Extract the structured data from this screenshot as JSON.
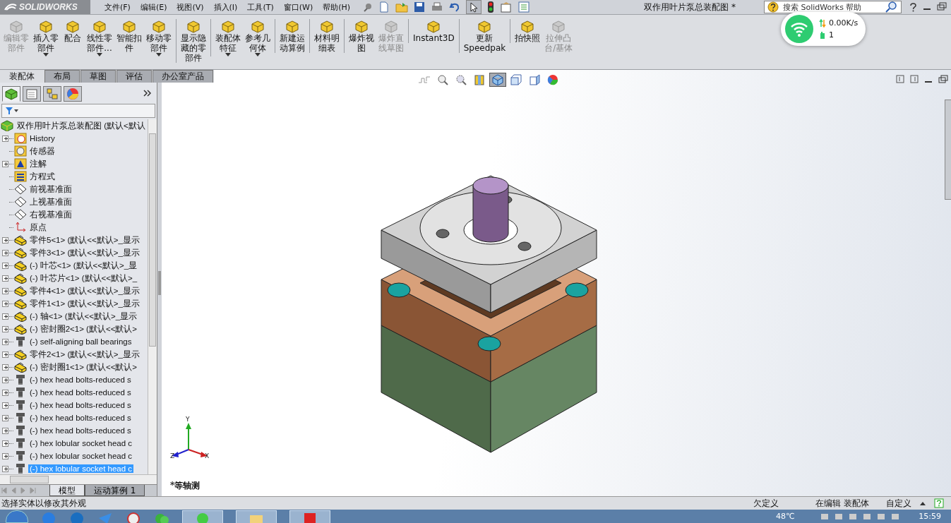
{
  "titlebar": {
    "brand": "SOLIDWORKS",
    "menu": [
      "文件(F)",
      "编辑(E)",
      "视图(V)",
      "插入(I)",
      "工具(T)",
      "窗口(W)",
      "帮助(H)"
    ],
    "title": "双作用叶片泵总装配图 *",
    "search": {
      "placeholder": "搜索 SolidWorks 帮助"
    }
  },
  "network_widget": {
    "speed": "0.00K/s",
    "count": "1"
  },
  "commands": [
    {
      "lines": [
        "编辑零",
        "部件"
      ],
      "disabled": true,
      "has_menu": false,
      "separator_before": false
    },
    {
      "lines": [
        "插入零",
        "部件"
      ],
      "disabled": false,
      "has_menu": true,
      "separator_before": false
    },
    {
      "lines": [
        "配合"
      ],
      "disabled": false,
      "has_menu": false,
      "separator_before": false
    },
    {
      "lines": [
        "线性零",
        "部件..."
      ],
      "disabled": false,
      "has_menu": true,
      "separator_before": false
    },
    {
      "lines": [
        "智能扣",
        "件"
      ],
      "disabled": false,
      "has_menu": false,
      "separator_before": false
    },
    {
      "lines": [
        "移动零",
        "部件"
      ],
      "disabled": false,
      "has_menu": true,
      "separator_before": false
    },
    {
      "lines": [
        "显示隐",
        "藏的零",
        "部件"
      ],
      "disabled": false,
      "has_menu": false,
      "separator_before": true
    },
    {
      "lines": [
        "装配体",
        "特征"
      ],
      "disabled": false,
      "has_menu": true,
      "separator_before": true
    },
    {
      "lines": [
        "参考几",
        "何体"
      ],
      "disabled": false,
      "has_menu": true,
      "separator_before": false
    },
    {
      "lines": [
        "新建运",
        "动算例"
      ],
      "disabled": false,
      "has_menu": false,
      "separator_before": true
    },
    {
      "lines": [
        "材料明",
        "细表"
      ],
      "disabled": false,
      "has_menu": false,
      "separator_before": true
    },
    {
      "lines": [
        "爆炸视",
        "图"
      ],
      "disabled": false,
      "has_menu": false,
      "separator_before": true
    },
    {
      "lines": [
        "爆炸直",
        "线草图"
      ],
      "disabled": true,
      "has_menu": false,
      "separator_before": false
    },
    {
      "lines": [
        "Instant3D"
      ],
      "disabled": false,
      "has_menu": false,
      "separator_before": true
    },
    {
      "lines": [
        "更新",
        "Speedpak"
      ],
      "disabled": false,
      "has_menu": false,
      "separator_before": true
    },
    {
      "lines": [
        "拍快照"
      ],
      "disabled": false,
      "has_menu": false,
      "separator_before": true
    },
    {
      "lines": [
        "拉伸凸",
        "台/基体"
      ],
      "disabled": true,
      "has_menu": false,
      "separator_before": false
    }
  ],
  "tabs": [
    {
      "label": "装配体",
      "selected": true
    },
    {
      "label": "布局",
      "selected": false
    },
    {
      "label": "草图",
      "selected": false
    },
    {
      "label": "评估",
      "selected": false
    },
    {
      "label": "办公室产品",
      "selected": false
    }
  ],
  "panel_tabs": [
    {
      "kind": "tree",
      "selected": true
    },
    {
      "kind": "property",
      "selected": false
    },
    {
      "kind": "config",
      "selected": false
    },
    {
      "kind": "display",
      "selected": false
    }
  ],
  "tree": {
    "text": "双作用叶片泵总装配图  (默认<默认",
    "kind": "assembly",
    "children": [
      {
        "text": "History",
        "kind": "history",
        "expandable": true,
        "selected": false
      },
      {
        "text": "传感器",
        "kind": "sensor",
        "expandable": false,
        "selected": false
      },
      {
        "text": "注解",
        "kind": "annotation",
        "expandable": true,
        "selected": false
      },
      {
        "text": "方程式",
        "kind": "equation",
        "expandable": false,
        "selected": false
      },
      {
        "text": "前视基准面",
        "kind": "plane",
        "expandable": false,
        "selected": false
      },
      {
        "text": "上视基准面",
        "kind": "plane",
        "expandable": false,
        "selected": false
      },
      {
        "text": "右视基准面",
        "kind": "plane",
        "expandable": false,
        "selected": false
      },
      {
        "text": "原点",
        "kind": "origin",
        "expandable": false,
        "selected": false
      },
      {
        "text": "零件5<1> (默认<<默认>_显示",
        "kind": "part",
        "expandable": true,
        "selected": false
      },
      {
        "text": "零件3<1> (默认<<默认>_显示",
        "kind": "part",
        "expandable": true,
        "selected": false
      },
      {
        "text": "(-) 叶芯<1> (默认<<默认>_显",
        "kind": "part",
        "expandable": true,
        "selected": false
      },
      {
        "text": "(-) 叶芯片<1> (默认<<默认>_",
        "kind": "part",
        "expandable": true,
        "selected": false
      },
      {
        "text": "零件4<1> (默认<<默认>_显示",
        "kind": "part",
        "expandable": true,
        "selected": false
      },
      {
        "text": "零件1<1> (默认<<默认>_显示",
        "kind": "part",
        "expandable": true,
        "selected": false
      },
      {
        "text": "(-) 轴<1> (默认<<默认>_显示",
        "kind": "part",
        "expandable": true,
        "selected": false
      },
      {
        "text": "(-) 密封圈2<1> (默认<<默认>",
        "kind": "part",
        "expandable": true,
        "selected": false
      },
      {
        "text": "(-) self-aligning ball bearings",
        "kind": "bolt",
        "expandable": true,
        "selected": false
      },
      {
        "text": "零件2<1> (默认<<默认>_显示",
        "kind": "part",
        "expandable": true,
        "selected": false
      },
      {
        "text": "(-) 密封圈1<1> (默认<<默认>",
        "kind": "part",
        "expandable": true,
        "selected": false
      },
      {
        "text": "(-) hex head bolts-reduced s",
        "kind": "bolt",
        "expandable": true,
        "selected": false
      },
      {
        "text": "(-) hex head bolts-reduced s",
        "kind": "bolt",
        "expandable": true,
        "selected": false
      },
      {
        "text": "(-) hex head bolts-reduced s",
        "kind": "bolt",
        "expandable": true,
        "selected": false
      },
      {
        "text": "(-) hex head bolts-reduced s",
        "kind": "bolt",
        "expandable": true,
        "selected": false
      },
      {
        "text": "(-) hex head bolts-reduced s",
        "kind": "bolt",
        "expandable": true,
        "selected": false
      },
      {
        "text": "(-) hex lobular socket head c",
        "kind": "bolt",
        "expandable": true,
        "selected": false
      },
      {
        "text": "(-) hex lobular socket head c",
        "kind": "bolt",
        "expandable": true,
        "selected": false
      },
      {
        "text": "(-) hex lobular socket head c",
        "kind": "bolt",
        "expandable": true,
        "selected": true
      }
    ]
  },
  "bottom_tabs": [
    {
      "label": "模型",
      "selected": true
    },
    {
      "label": "运动算例 1",
      "selected": false
    }
  ],
  "view_toolbar": [
    {
      "kind": "prev",
      "selected": false
    },
    {
      "kind": "zoomfit",
      "selected": false
    },
    {
      "kind": "zoom",
      "selected": false
    },
    {
      "kind": "section",
      "selected": false
    },
    {
      "kind": "iso",
      "selected": true
    },
    {
      "kind": "orient",
      "selected": false
    },
    {
      "kind": "display",
      "selected": false
    },
    {
      "kind": "appearance",
      "selected": false
    }
  ],
  "viewport": {
    "view_name": "*等轴测",
    "triad": [
      "Y",
      "Z",
      "X"
    ]
  },
  "status_bar": {
    "message": "选择实体以修改其外观",
    "fields": [
      "欠定义",
      "在编辑 装配体",
      "自定义"
    ]
  },
  "taskbar": {
    "temperature": "48℃",
    "time": "15:59"
  }
}
